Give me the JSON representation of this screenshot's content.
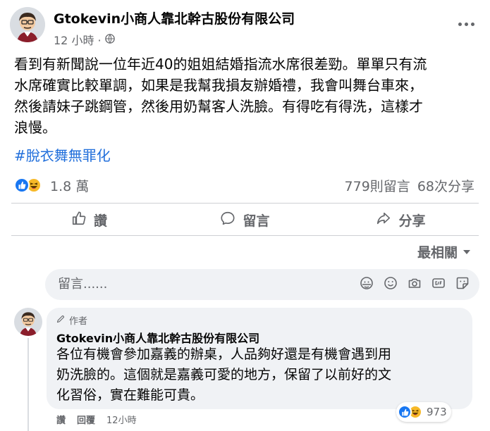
{
  "post": {
    "author": "Gtokevin小商人靠北幹古股份有限公司",
    "time": "12 小時 · ",
    "text_lines": [
      "看到有新聞說一位年近40的姐姐結婚指流水席很差勁。單單只有流",
      "水席確實比較單調，如果是我幫我損友辦婚禮，我會叫舞台車來，",
      "然後請妹子跳鋼管，然後用奶幫客人洗臉。有得吃有得洗，這樣才",
      "浪慢。"
    ],
    "hashtag": "#脫衣舞無罪化",
    "reaction_count": "1.8 萬",
    "comments_count": "779則留言",
    "shares_count": "68次分享"
  },
  "actions": {
    "like": "讚",
    "comment": "留言",
    "share": "分享"
  },
  "sort": {
    "label": "最相關"
  },
  "composer": {
    "placeholder": "留言......"
  },
  "comment": {
    "badge": "作者",
    "author": "Gtokevin小商人靠北幹古股份有限公司",
    "text_lines": [
      "各位有機會參加嘉義的辦桌，人品夠好還是有機會遇到用",
      "奶洗臉的。這個就是嘉義可愛的地方，保留了以前好的文",
      "化習俗，實在難能可貴。"
    ],
    "reaction_count": "973",
    "like_label": "讚",
    "reply_label": "回覆",
    "time": "12小時"
  },
  "icons": {
    "globe": "globe-icon",
    "more": "more-horizontal-icon",
    "like": "thumbs-up-icon",
    "comment": "comment-bubble-icon",
    "share": "share-arrow-icon",
    "haha": "haha-reaction-icon",
    "avatar_sticker": "sticker-icon",
    "emoji": "emoji-icon",
    "camera": "camera-icon",
    "gif": "gif-icon",
    "sticker": "sticker-icon",
    "author_badge": "pen-icon"
  },
  "colors": {
    "link": "#216fdb",
    "like_blue": "#1877f2",
    "haha_yellow": "#f7b928",
    "secondary_text": "#65676b",
    "bubble_bg": "#f0f2f5"
  }
}
